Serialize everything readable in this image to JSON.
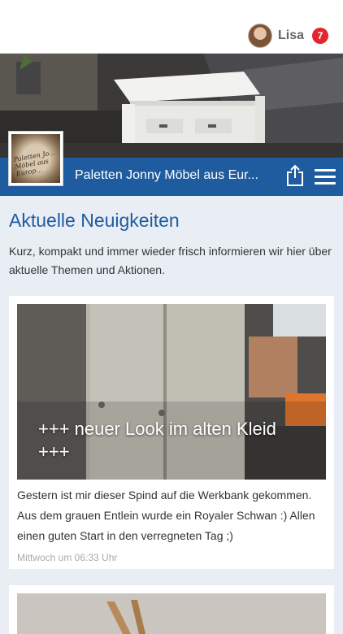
{
  "header": {
    "user_name": "Lisa",
    "notification_count": "7"
  },
  "page": {
    "name": "Paletten Jonny Möbel aus Eur...",
    "logo_text": "Paletten Jo... Möbel aus Europ...",
    "brand_color": "#1f5b9f"
  },
  "section": {
    "title": "Aktuelle Neuigkeiten",
    "description": "Kurz, kompakt und immer wieder frisch informieren wir hier über aktuelle Themen und Aktionen."
  },
  "posts": [
    {
      "image_title": "+++ neuer Look im alten Kleid +++",
      "text": "Gestern ist mir dieser Spind auf die Werkbank gekommen. Aus dem grauen Entlein wurde ein Royaler Schwan :) Allen einen guten Start in den verregneten Tag ;)",
      "time": "Mittwoch um 06:33 Uhr"
    }
  ],
  "icons": {
    "share": "share-icon",
    "menu": "hamburger-menu-icon",
    "avatar": "user-avatar"
  }
}
